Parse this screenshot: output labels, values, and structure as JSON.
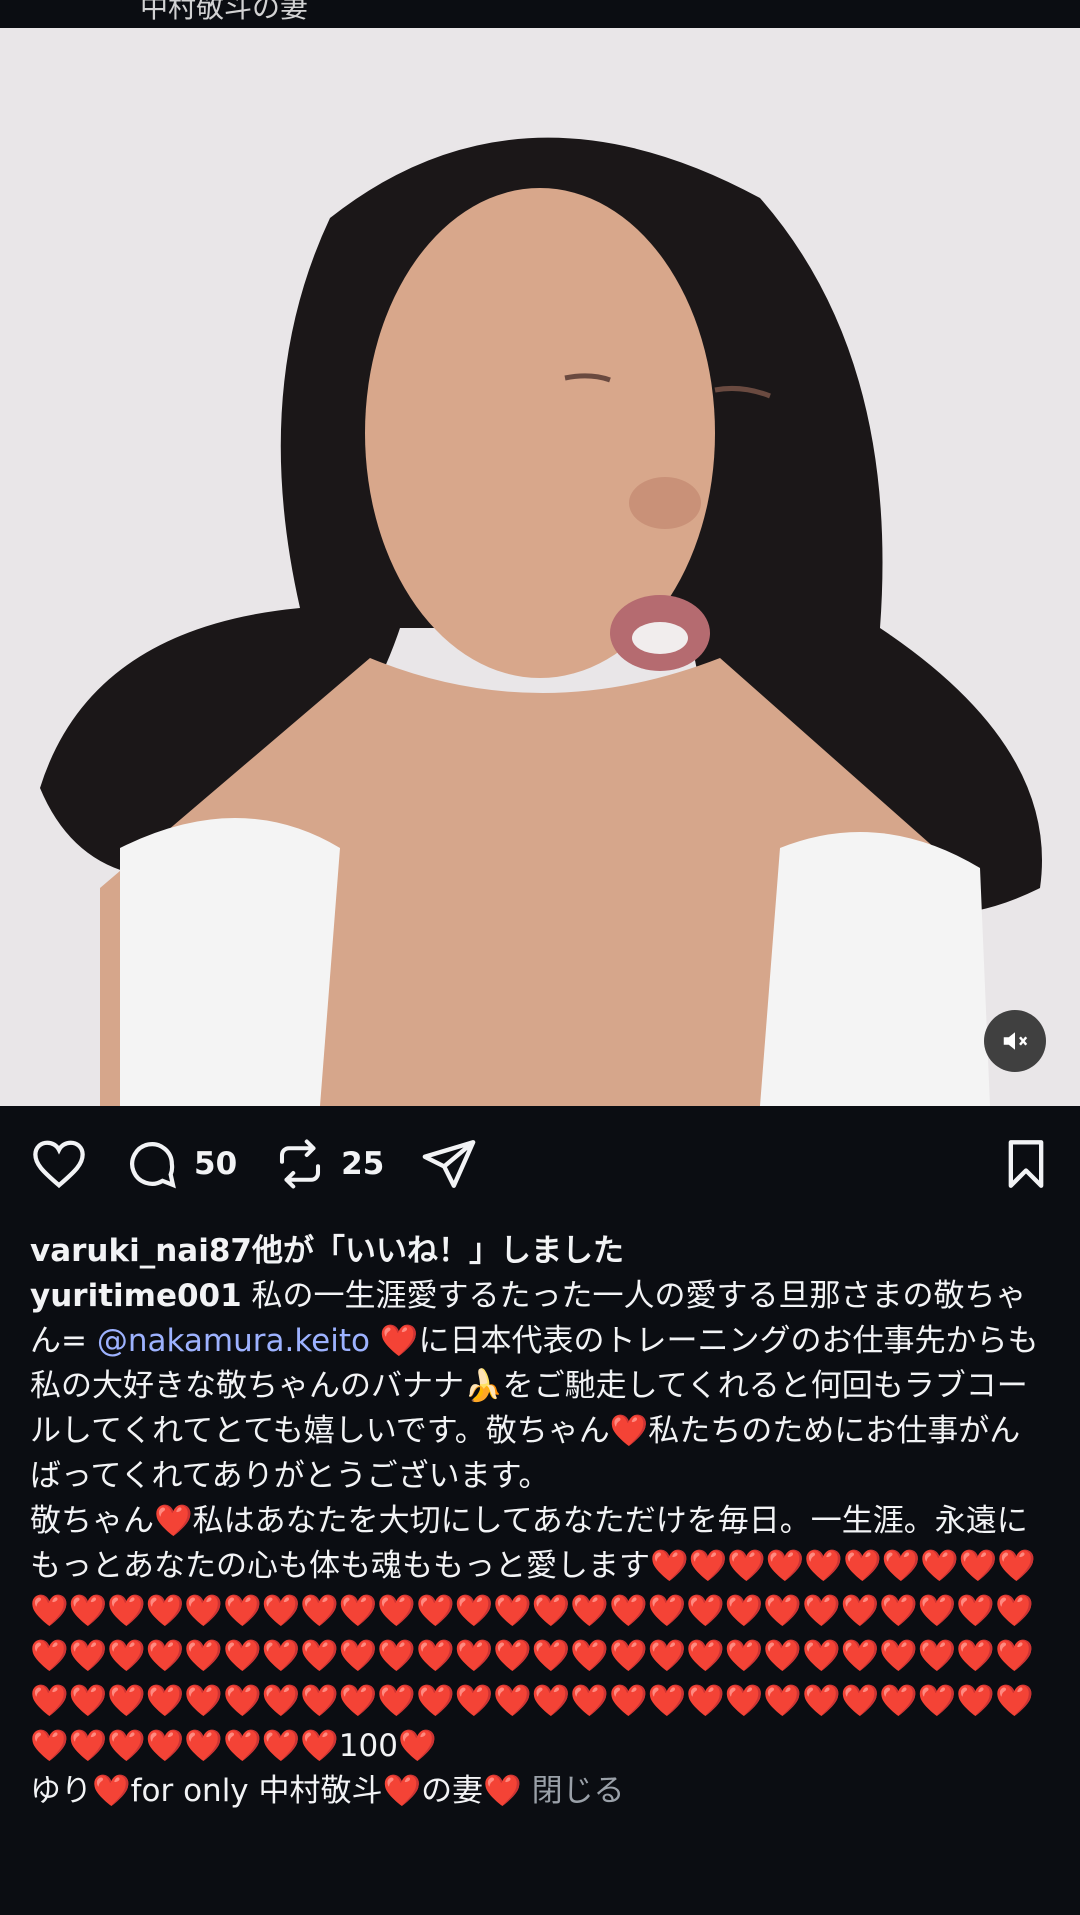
{
  "top_header_text": "中村敬斗の妻",
  "media": {
    "mute_icon": "speaker-muted-icon"
  },
  "actions": {
    "comment_count": "50",
    "repost_count": "25"
  },
  "likes_text": "varuki_nai87他が「いいね！」しました",
  "caption": {
    "username": "yuritime001",
    "part1": " 私の一生涯愛するたった一人の愛する旦那さまの敬ちゃん= ",
    "mention": "@nakamura.keito",
    "part2": " ❤️に日本代表のトレーニングのお仕事先からも私の大好きな敬ちゃんのバナナ🍌をご馳走してくれると何回もラブコールしてくれてとても嬉しいです。敬ちゃん❤️私たちのためにお仕事がんばってくれてありがとうございます。",
    "part3": "敬ちゃん❤️私はあなたを大切にしてあなただけを毎日。一生涯。永遠にもっとあなたの心も体も魂ももっと愛します❤️❤️❤️❤️❤️❤️❤️❤️❤️❤️❤️❤️❤️❤️❤️❤️❤️❤️❤️❤️❤️❤️❤️❤️❤️❤️❤️❤️❤️❤️❤️❤️❤️❤️❤️❤️❤️❤️❤️❤️❤️❤️❤️❤️❤️❤️❤️❤️❤️❤️❤️❤️❤️❤️❤️❤️❤️❤️❤️❤️❤️❤️❤️❤️❤️❤️❤️❤️❤️❤️❤️❤️❤️❤️❤️❤️❤️❤️❤️❤️❤️❤️❤️❤️❤️❤️❤️❤️❤️❤️❤️❤️❤️❤️❤️❤️100❤️",
    "part4": "ゆり❤️for only 中村敬斗❤️の妻❤️ ",
    "close_label": "閉じる"
  }
}
